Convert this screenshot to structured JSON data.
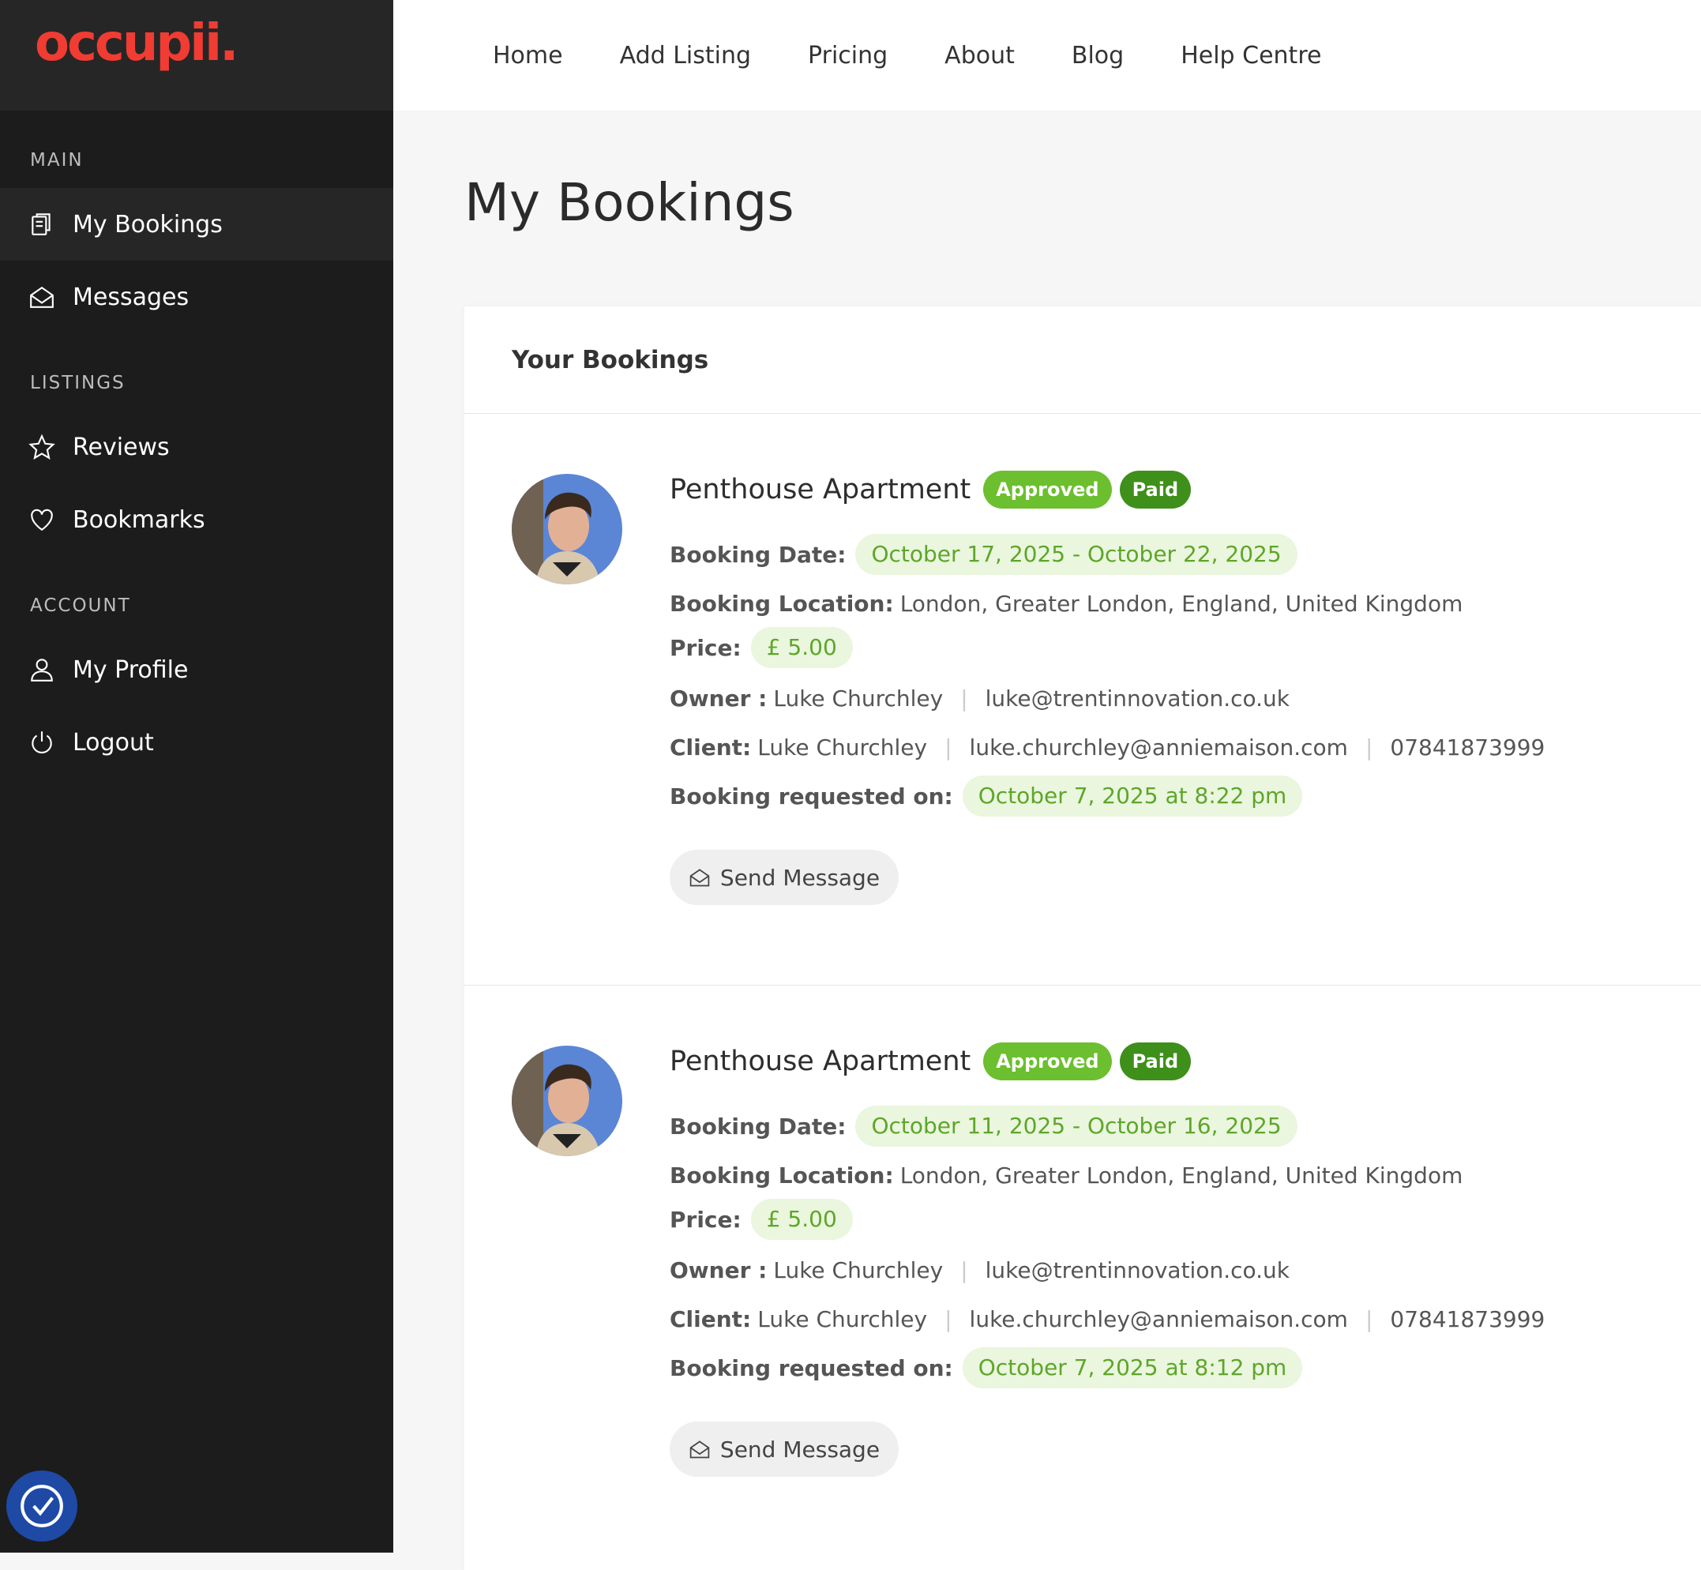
{
  "brand": {
    "logo_text": "occupii."
  },
  "sidebar": {
    "sections": [
      {
        "heading": "MAIN",
        "items": [
          {
            "label": "My Bookings",
            "icon": "document-icon",
            "active": true
          },
          {
            "label": "Messages",
            "icon": "envelope-icon"
          }
        ]
      },
      {
        "heading": "LISTINGS",
        "items": [
          {
            "label": "Reviews",
            "icon": "star-icon"
          },
          {
            "label": "Bookmarks",
            "icon": "heart-icon"
          }
        ]
      },
      {
        "heading": "ACCOUNT",
        "items": [
          {
            "label": "My Profile",
            "icon": "user-icon"
          },
          {
            "label": "Logout",
            "icon": "power-icon"
          }
        ]
      }
    ]
  },
  "topnav": {
    "links": [
      "Home",
      "Add Listing",
      "Pricing",
      "About",
      "Blog",
      "Help Centre"
    ]
  },
  "page": {
    "title": "My Bookings",
    "card_title": "Your Bookings"
  },
  "labels": {
    "booking_date": "Booking Date:",
    "booking_location": "Booking Location:",
    "price": "Price:",
    "owner": "Owner :",
    "client": "Client:",
    "requested_on": "Booking requested on:",
    "send_message": "Send Message",
    "status_approved": "Approved",
    "status_paid": "Paid"
  },
  "bookings": [
    {
      "title": "Penthouse Apartment",
      "date_range": "October 17, 2025 - October 22, 2025",
      "location": "London, Greater London, England, United Kingdom",
      "price": "£ 5.00",
      "owner_name": "Luke Churchley",
      "owner_email": "luke@trentinnovation.co.uk",
      "client_name": "Luke Churchley",
      "client_email": "luke.churchley@anniemaison.com",
      "client_phone": "07841873999",
      "requested_on": "October 7, 2025 at 8:22 pm"
    },
    {
      "title": "Penthouse Apartment",
      "date_range": "October 11, 2025 - October 16, 2025",
      "location": "London, Greater London, England, United Kingdom",
      "price": "£ 5.00",
      "owner_name": "Luke Churchley",
      "owner_email": "luke@trentinnovation.co.uk",
      "client_name": "Luke Churchley",
      "client_email": "luke.churchley@anniemaison.com",
      "client_phone": "07841873999",
      "requested_on": "October 7, 2025 at 8:12 pm"
    }
  ],
  "colors": {
    "brand_red": "#f03c32",
    "approved": "#6cbf2f",
    "paid": "#3f8f1b",
    "sidebar_bg": "#1c1c1c"
  }
}
